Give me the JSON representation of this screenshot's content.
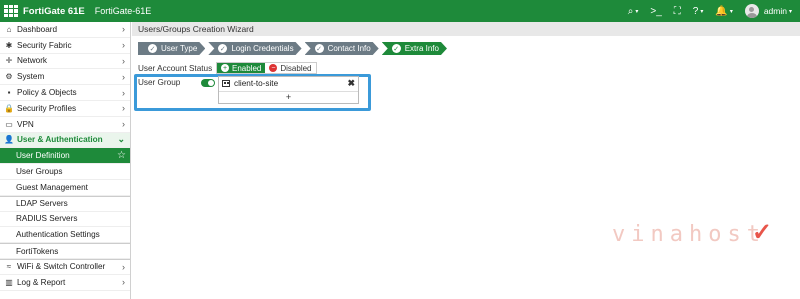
{
  "topbar": {
    "brand": "FortiGate 61E",
    "hostname": "FortiGate-61E",
    "icons": {
      "search": "search-icon",
      "cli": "terminal-icon",
      "fullscreen": "fullscreen-icon",
      "help": "help-icon",
      "notifications": "bell-icon"
    },
    "search_glyph": "⌕",
    "cli_glyph": ">_",
    "fullscreen_glyph": "⛶",
    "help_glyph": "?",
    "bell_glyph": "🔔",
    "caret": "▾",
    "user": "admin"
  },
  "sidebar": {
    "items": [
      {
        "label": "Dashboard",
        "icon": "⌂",
        "chev": "›"
      },
      {
        "label": "Security Fabric",
        "icon": "✱",
        "chev": "›"
      },
      {
        "label": "Network",
        "icon": "✛",
        "chev": "›"
      },
      {
        "label": "System",
        "icon": "⚙",
        "chev": "›"
      },
      {
        "label": "Policy & Objects",
        "icon": "▪",
        "chev": "›"
      },
      {
        "label": "Security Profiles",
        "icon": "🔒",
        "chev": "›"
      },
      {
        "label": "VPN",
        "icon": "▭",
        "chev": "›"
      },
      {
        "label": "User & Authentication",
        "icon": "👤",
        "chev": "⌄"
      }
    ],
    "sub_items": [
      {
        "label": "User Definition"
      },
      {
        "label": "User Groups"
      },
      {
        "label": "Guest Management"
      },
      {
        "label": "LDAP Servers"
      },
      {
        "label": "RADIUS Servers"
      },
      {
        "label": "Authentication Settings"
      },
      {
        "label": "FortiTokens"
      }
    ],
    "bottom_items": [
      {
        "label": "WiFi & Switch Controller",
        "icon": "≈",
        "chev": "›"
      },
      {
        "label": "Log & Report",
        "icon": "▥",
        "chev": "›"
      }
    ],
    "star": "☆"
  },
  "main": {
    "title": "Users/Groups Creation Wizard",
    "steps": [
      {
        "label": "User Type"
      },
      {
        "label": "Login Credentials"
      },
      {
        "label": "Contact Info"
      },
      {
        "label": "Extra Info"
      }
    ],
    "check": "✓",
    "status_label": "User Account Status",
    "enabled_label": "Enabled",
    "disabled_label": "Disabled",
    "plus_glyph": "+",
    "minus_glyph": "−",
    "group_label": "User Group",
    "group_entry": "client-to-site",
    "remove_glyph": "✖",
    "add_glyph": "+"
  },
  "watermark": {
    "text": "vinahost",
    "mark": "✓"
  },
  "colors": {
    "brand_green": "#1e8a3a",
    "step_gray": "#6c7b85",
    "highlight_blue": "#3b9ad9"
  }
}
